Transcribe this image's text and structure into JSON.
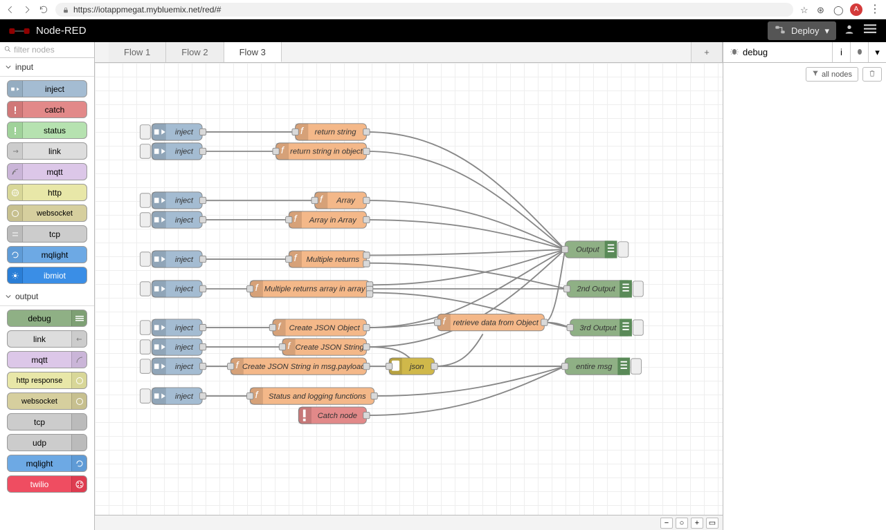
{
  "chrome": {
    "url": "https://iotappmegat.mybluemix.net/red/#",
    "avatar": "A"
  },
  "header": {
    "brand": "Node-RED",
    "deploy": "Deploy"
  },
  "palette": {
    "filter_placeholder": "filter nodes",
    "cat_input": "input",
    "cat_output": "output",
    "input_nodes": {
      "inject": "inject",
      "catch": "catch",
      "status": "status",
      "link": "link",
      "mqtt": "mqtt",
      "http": "http",
      "websocket": "websocket",
      "tcp": "tcp",
      "mqlight": "mqlight",
      "ibmiot": "ibmiot"
    },
    "output_nodes": {
      "debug": "debug",
      "link": "link",
      "mqtt": "mqtt",
      "httpresponse": "http response",
      "websocket": "websocket",
      "tcp": "tcp",
      "udp": "udp",
      "mqlight": "mqlight",
      "twilio": "twilio"
    }
  },
  "tabs": {
    "t1": "Flow 1",
    "t2": "Flow 2",
    "t3": "Flow 3",
    "add": "+"
  },
  "sidebar": {
    "title": "debug",
    "info_icon": "i",
    "all_nodes": "all nodes"
  },
  "footer": {
    "minus": "−",
    "zero": "○",
    "plus": "+",
    "map": "▭"
  },
  "canvas": {
    "inject": "inject",
    "return_string": "return string",
    "return_string_obj": "return string in object",
    "array": "Array",
    "array_in_array": "Array in Array",
    "multiple_returns": "Multiple returns",
    "multiple_returns_arr": "Multiple returns array in array",
    "create_json_obj": "Create JSON Object",
    "create_json_str": "Create JSON String",
    "create_json_msg": "Create JSON String in msg.payload",
    "status_log": "Status and logging functions",
    "catch_node": "Catch node",
    "retrieve": "retrieve data from Object",
    "json": "json",
    "out1": "Output",
    "out2": "2nd Output",
    "out3": "3rd Output",
    "out4": "entire msg"
  }
}
